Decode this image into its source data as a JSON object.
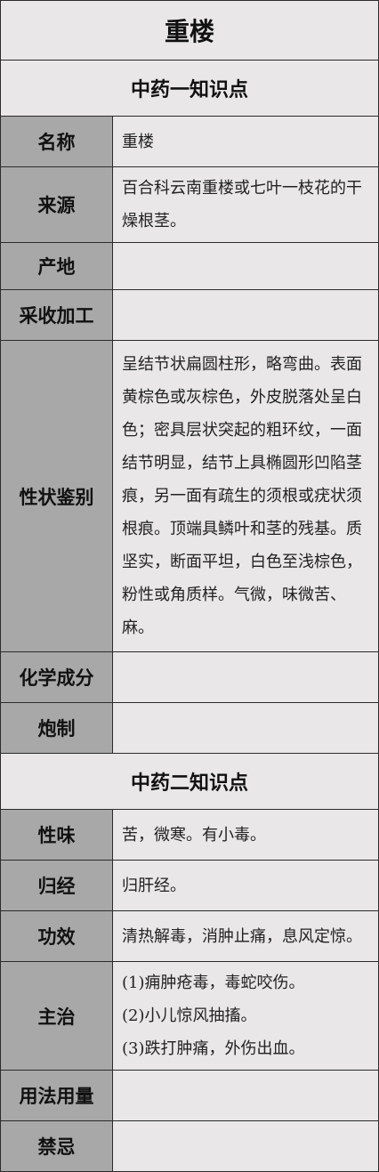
{
  "title": "重楼",
  "section1": {
    "heading": "中药一知识点",
    "rows": [
      {
        "label": "名称",
        "value": "重楼"
      },
      {
        "label": "来源",
        "value": "百合科云南重楼或七叶一枝花的干燥根茎。"
      },
      {
        "label": "产地",
        "value": ""
      },
      {
        "label": "采收加工",
        "value": ""
      },
      {
        "label": "性状鉴别",
        "value": "呈结节状扁圆柱形，略弯曲。表面黄棕色或灰棕色，外皮脱落处呈白色；密具层状突起的粗环纹，一面结节明显，结节上具椭圆形凹陷茎痕，另一面有疏生的须根或疣状须根痕。顶端具鳞叶和茎的残基。质坚实，断面平坦，白色至浅棕色，粉性或角质样。气微，味微苦、麻。"
      },
      {
        "label": "化学成分",
        "value": ""
      },
      {
        "label": "炮制",
        "value": ""
      }
    ]
  },
  "section2": {
    "heading": "中药二知识点",
    "rows": [
      {
        "label": "性味",
        "value": "苦，微寒。有小毒。"
      },
      {
        "label": "归经",
        "value": "归肝经。"
      },
      {
        "label": "功效",
        "value": "清热解毒，消肿止痛，息风定惊。"
      },
      {
        "label": "主治",
        "lines": [
          "(1)痈肿疮毒，毒蛇咬伤。",
          "(2)小儿惊风抽搐。",
          "(3)跌打肿痛，外伤出血。"
        ]
      },
      {
        "label": "用法用量",
        "value": ""
      },
      {
        "label": "禁忌",
        "value": ""
      }
    ]
  }
}
